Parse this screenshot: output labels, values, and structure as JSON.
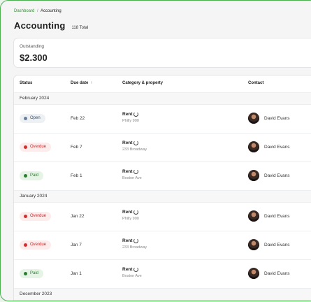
{
  "breadcrumb": {
    "parent": "Dashboard",
    "separator": "/",
    "current": "Accounting"
  },
  "header": {
    "title": "Accounting",
    "total": "118 Total"
  },
  "summary": {
    "label": "Outstanding",
    "value": "$2.300"
  },
  "table": {
    "columns": {
      "status": "Status",
      "due_date": "Due date",
      "category": "Category & property",
      "contact": "Contact"
    },
    "sort_icon": "↑",
    "groups": [
      {
        "label": "February 2024",
        "rows": [
          {
            "status": "Open",
            "due": "Feb 22",
            "category": "Rent",
            "property": "Philly 900",
            "contact": "David Evans"
          },
          {
            "status": "Overdue",
            "due": "Feb 7",
            "category": "Rent",
            "property": "233 Broadway",
            "contact": "David Evans"
          },
          {
            "status": "Paid",
            "due": "Feb 1",
            "category": "Rent",
            "property": "Boston Ave",
            "contact": "David Evans"
          }
        ]
      },
      {
        "label": "January 2024",
        "rows": [
          {
            "status": "Overdue",
            "due": "Jan 22",
            "category": "Rent",
            "property": "Philly 900",
            "contact": "David Evans"
          },
          {
            "status": "Overdue",
            "due": "Jan 7",
            "category": "Rent",
            "property": "233 Broadway",
            "contact": "David Evans"
          },
          {
            "status": "Paid",
            "due": "Jan 1",
            "category": "Rent",
            "property": "Boston Ave",
            "contact": "David Evans"
          }
        ]
      },
      {
        "label": "December 2023",
        "rows": []
      }
    ]
  },
  "colors": {
    "open": "#6b7f99",
    "overdue": "#d32f2f",
    "paid": "#2e7d32",
    "accent": "#4caf50"
  }
}
